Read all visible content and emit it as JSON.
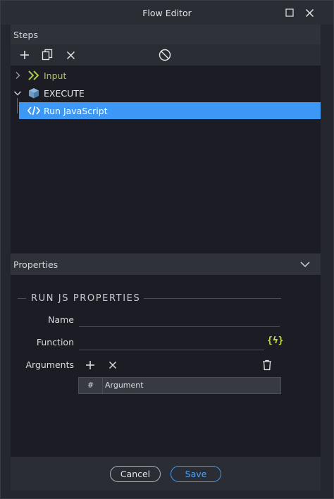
{
  "window": {
    "title": "Flow Editor"
  },
  "steps": {
    "header": "Steps",
    "tree": [
      {
        "label": "Input",
        "color": "#a9c94a"
      },
      {
        "label": "EXECUTE",
        "color": "#e6e8ec"
      },
      {
        "label": "Run JavaScript",
        "color": "#ffffff"
      }
    ]
  },
  "properties": {
    "header": "Properties",
    "section_title": "RUN JS PROPERTIES",
    "name_label": "Name",
    "function_label": "Function",
    "function_icon": "{ϟ}",
    "arguments_label": "Arguments",
    "table": {
      "columns": [
        "#",
        "Argument"
      ]
    }
  },
  "footer": {
    "cancel_label": "Cancel",
    "save_label": "Save"
  },
  "colors": {
    "accent": "#3c98f4",
    "input_green": "#a9c94a",
    "function_icon": "#c6d64a"
  },
  "icons": {
    "titlebar": [
      "maximize-icon",
      "close-icon"
    ],
    "toolbar": [
      "add-icon",
      "copy-icon",
      "delete-icon",
      "disable-icon"
    ],
    "tree": [
      "chevron-right-icon",
      "double-chevron-icon",
      "chevron-down-icon",
      "cube-icon",
      "code-icon"
    ],
    "arguments": [
      "add-icon",
      "delete-icon",
      "trash-icon"
    ],
    "properties_header": [
      "chevron-down-icon"
    ]
  }
}
